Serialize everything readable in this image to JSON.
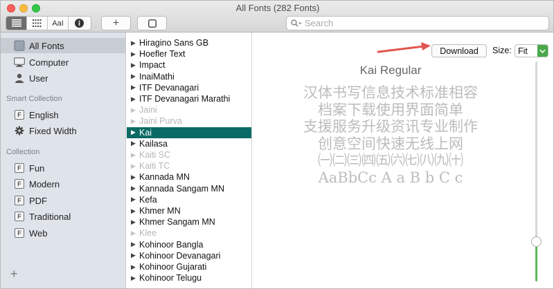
{
  "window": {
    "title": "All Fonts (282 Fonts)"
  },
  "toolbar": {
    "view_buttons": [
      "list-view-icon",
      "grid-view-icon",
      "sample-view-icon",
      "info-icon"
    ],
    "sample_label": "AaI",
    "add_label": "+",
    "search": {
      "placeholder": "Search",
      "value": ""
    }
  },
  "sidebar": {
    "library": [
      {
        "label": "All Fonts",
        "icon": "font-library-icon",
        "selected": true
      },
      {
        "label": "Computer",
        "icon": "computer-icon"
      },
      {
        "label": "User",
        "icon": "user-icon"
      }
    ],
    "smart_heading": "Smart Collection",
    "smart": [
      {
        "label": "English",
        "icon": "font-collection-icon"
      },
      {
        "label": "Fixed Width",
        "icon": "gear-icon"
      }
    ],
    "collection_heading": "Collection",
    "collections": [
      {
        "label": "Fun"
      },
      {
        "label": "Modern"
      },
      {
        "label": "PDF"
      },
      {
        "label": "Traditional"
      },
      {
        "label": "Web"
      }
    ],
    "add_label": "+"
  },
  "font_list": [
    {
      "name": "Hiragino Sans GB",
      "state": "normal"
    },
    {
      "name": "Hoefler Text",
      "state": "normal"
    },
    {
      "name": "Impact",
      "state": "normal"
    },
    {
      "name": "InaiMathi",
      "state": "normal"
    },
    {
      "name": "ITF Devanagari",
      "state": "normal"
    },
    {
      "name": "ITF Devanagari Marathi",
      "state": "normal"
    },
    {
      "name": "Jaini",
      "state": "disabled"
    },
    {
      "name": "Jaini Purva",
      "state": "disabled"
    },
    {
      "name": "Kai",
      "state": "selected"
    },
    {
      "name": "Kailasa",
      "state": "normal"
    },
    {
      "name": "Kaiti SC",
      "state": "disabled"
    },
    {
      "name": "Kaiti TC",
      "state": "disabled"
    },
    {
      "name": "Kannada MN",
      "state": "normal"
    },
    {
      "name": "Kannada Sangam MN",
      "state": "normal"
    },
    {
      "name": "Kefa",
      "state": "normal"
    },
    {
      "name": "Khmer MN",
      "state": "normal"
    },
    {
      "name": "Khmer Sangam MN",
      "state": "normal"
    },
    {
      "name": "Klee",
      "state": "disabled"
    },
    {
      "name": "Kohinoor Bangla",
      "state": "normal"
    },
    {
      "name": "Kohinoor Devanagari",
      "state": "normal"
    },
    {
      "name": "Kohinoor Gujarati",
      "state": "normal"
    },
    {
      "name": "Kohinoor Telugu",
      "state": "normal"
    }
  ],
  "preview": {
    "download_label": "Download",
    "size_label": "Size:",
    "size_value": "Fit",
    "font_name": "Kai Regular",
    "sample_lines": [
      "汉体书写信息技术标准相容",
      "档案下载使用界面简单",
      "支援服务升级资讯专业制作",
      "创意空间快速无线上网",
      "㈠㈡㈢㈣㈤㈥㈦㈧㈨㈩",
      "AaBbCc A a B b C c"
    ],
    "slider_level": 0.17
  },
  "colors": {
    "selection": "#0a6b65",
    "sidebar_bg": "#dfe3ea",
    "annotation_arrow": "#e0554f",
    "slider_fill": "#5cb85c"
  }
}
